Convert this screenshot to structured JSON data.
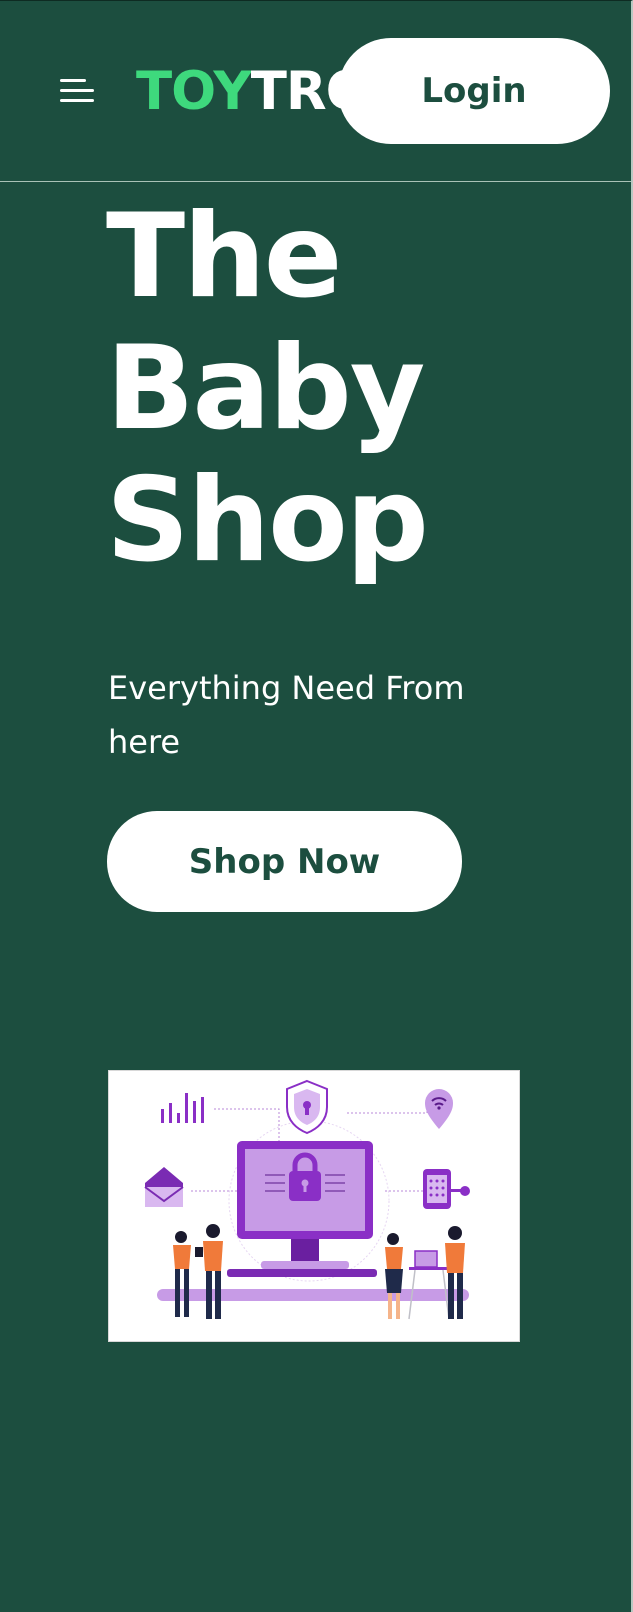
{
  "header": {
    "menu_icon": "hamburger-menu-icon",
    "logo": {
      "part1": "TOY",
      "part2": "TRO"
    },
    "login_label": "Login"
  },
  "hero": {
    "title_lines": [
      "The",
      "Baby",
      "Shop"
    ],
    "subtitle": "Everything Need From here",
    "cta_label": "Shop Now"
  },
  "illustration": {
    "icons": [
      "bar-chart-icon",
      "shield-icon",
      "location-wifi-icon",
      "envelope-icon",
      "padlock-icon",
      "smartphone-key-icon",
      "people-icon"
    ]
  },
  "colors": {
    "background": "#1c4e3f",
    "logo_accent": "#3ed97d",
    "button_bg": "#ffffff",
    "button_text": "#1c4e3f",
    "illustration_purple": "#8a2fc6"
  }
}
